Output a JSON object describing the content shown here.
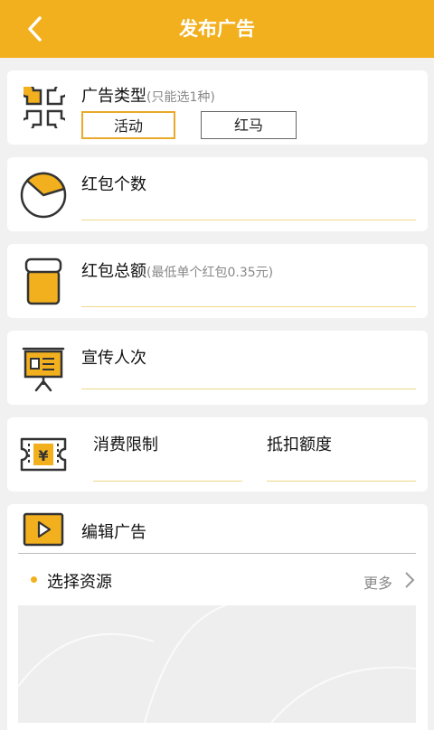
{
  "header": {
    "title": "发布广告"
  },
  "ad_type": {
    "label": "广告类型",
    "hint": "(只能选1种)",
    "options": [
      "活动",
      "红马"
    ]
  },
  "count": {
    "label": "红包个数"
  },
  "total": {
    "label": "红包总额",
    "hint": "(最低单个红包0.35元)"
  },
  "promo": {
    "label": "宣传人次"
  },
  "consume": {
    "limit_label": "消费限制",
    "deduct_label": "抵扣额度"
  },
  "edit": {
    "label": "编辑广告"
  },
  "resource": {
    "label": "选择资源",
    "more": "更多"
  },
  "colors": {
    "accent": "#f2b01e",
    "underline": "#f0d88a"
  }
}
